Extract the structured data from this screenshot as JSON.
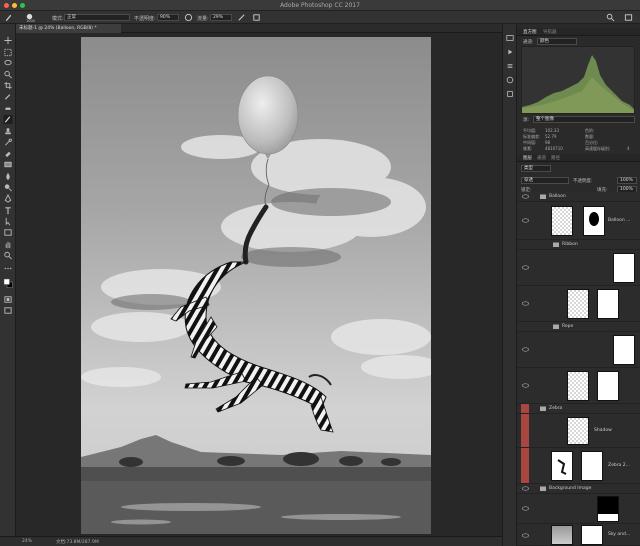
{
  "window": {
    "title": "Adobe Photoshop CC 2017"
  },
  "options_bar": {
    "brush_size": "1000",
    "mode_label": "模式:",
    "mode_value": "正常",
    "opacity_label": "不透明度:",
    "opacity_value": "90%",
    "flow_label": "流量:",
    "flow_value": "29%"
  },
  "document": {
    "tab_label": "未标题-1 @ 24% (Balloon, RGB/8) *"
  },
  "status": {
    "zoom": "24%",
    "doc_size": "文档:73.8M/287.9M"
  },
  "histogram_panel": {
    "tab_histogram": "直方图",
    "tab_navigator": "导航器",
    "channel_label": "通道:",
    "channel_value": "颜色",
    "source_label": "源:",
    "source_value": "整个图像",
    "stats": [
      {
        "l": "平均值:",
        "lv": "102.33",
        "r": "色阶:",
        "rv": ""
      },
      {
        "l": "标准偏差:",
        "lv": "52.79",
        "r": "数量:",
        "rv": ""
      },
      {
        "l": "中间值:",
        "lv": "98",
        "r": "百分位:",
        "rv": ""
      },
      {
        "l": "像素:",
        "lv": "4810710",
        "r": "高速缓存级别:",
        "rv": "4"
      }
    ]
  },
  "layers_panel": {
    "tab_layers": "图层",
    "tab_channels": "通道",
    "tab_paths": "路径",
    "filter_kind": "类型",
    "blend_mode": "穿透",
    "opacity_label": "不透明度:",
    "opacity_value": "100%",
    "lock_label": "锁定:",
    "fill_label": "填充:",
    "fill_value": "100%",
    "layers": {
      "balloon_group": "Balloon",
      "balloon_layer": "Balloon ...",
      "ribbon_group": "Ribbon",
      "rope_group": "Rope",
      "zebra_group": "Zebra",
      "shadow_layer": "Shadow",
      "zebra_layer": "Zebra 2...",
      "background_group": "Background Image",
      "sky_layer": "Sky and..."
    }
  },
  "colors": {
    "ui_bg": "#323232",
    "panel_bg": "#2a2a2a",
    "histogram_fill": "#6e8a4e",
    "zebra_group_highlight": "#a8473f"
  },
  "icons": {
    "brush": "brush-icon",
    "search": "search-icon",
    "eye": "eye-icon",
    "folder": "folder-icon"
  }
}
